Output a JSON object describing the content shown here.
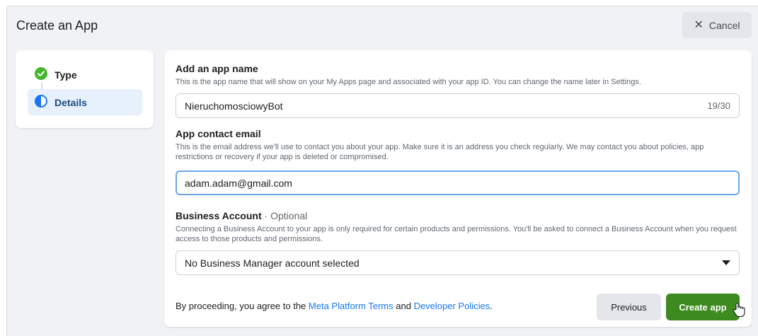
{
  "dialog": {
    "title": "Create an App",
    "cancel_label": "Cancel"
  },
  "steps": [
    {
      "label": "Type",
      "state": "complete"
    },
    {
      "label": "Details",
      "state": "in-progress"
    }
  ],
  "form": {
    "app_name": {
      "label": "Add an app name",
      "help": "This is the app name that will show on your My Apps page and associated with your app ID. You can change the name later in Settings.",
      "value": "NieruchomosciowyBot",
      "counter": "19/30"
    },
    "email": {
      "label": "App contact email",
      "help": "This is the email address we'll use to contact you about your app. Make sure it is an address you check regularly. We may contact you about policies, app restrictions or recovery if your app is deleted or compromised.",
      "value": "adam.adam@gmail.com"
    },
    "business": {
      "label": "Business Account",
      "optional": "· Optional",
      "help": "Connecting a Business Account to your app is only required for certain products and permissions. You'll be asked to connect a Business Account when you request access to those products and permissions.",
      "selected": "No Business Manager account selected"
    }
  },
  "footer": {
    "prefix": "By proceeding, you agree to the",
    "terms_link": "Meta Platform Terms",
    "conjunction": "and",
    "policies_link": "Developer Policies",
    "suffix": ".",
    "previous_label": "Previous",
    "create_label": "Create app"
  },
  "colors": {
    "primary_green": "#3d8b1e",
    "link_blue": "#1877f2",
    "step_check_green": "#42b72a",
    "focus_border": "#6ba6e8"
  }
}
